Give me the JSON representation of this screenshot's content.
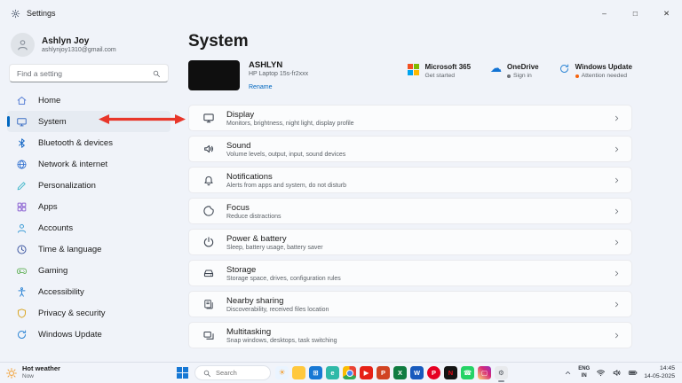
{
  "colors": {
    "accent": "#0067c0",
    "annotation_arrow": "#e8362a",
    "attention_dot": "#f7630c",
    "signin_dot": "#6f7379"
  },
  "titlebar": {
    "title": "Settings",
    "window_controls": {
      "minimize": "–",
      "maximize": "□",
      "close": "✕"
    }
  },
  "sidebar": {
    "user": {
      "name": "Ashlyn Joy",
      "email": "ashlynjoy1310@gmail.com"
    },
    "search_placeholder": "Find a setting",
    "items": [
      {
        "key": "home",
        "icon": "home",
        "label": "Home",
        "fg": "#5a81d6"
      },
      {
        "key": "system",
        "icon": "display",
        "label": "System",
        "fg": "#3c6fc4",
        "selected": true
      },
      {
        "key": "bluetooth-devices",
        "icon": "bluetooth",
        "label": "Bluetooth & devices",
        "fg": "#1467c6"
      },
      {
        "key": "network-internet",
        "icon": "network",
        "label": "Network & internet",
        "fg": "#2f6fd0"
      },
      {
        "key": "personalization",
        "icon": "personalization",
        "label": "Personalization",
        "fg": "#3fb6c9"
      },
      {
        "key": "apps",
        "icon": "apps",
        "label": "Apps",
        "fg": "#8d64d2"
      },
      {
        "key": "accounts",
        "icon": "person",
        "label": "Accounts",
        "fg": "#3a9bd5"
      },
      {
        "key": "time-language",
        "icon": "time",
        "label": "Time & language",
        "fg": "#39539f"
      },
      {
        "key": "gaming",
        "icon": "gaming",
        "label": "Gaming",
        "fg": "#56ab4a"
      },
      {
        "key": "accessibility",
        "icon": "accessibility",
        "label": "Accessibility",
        "fg": "#2f86d5"
      },
      {
        "key": "privacy-security",
        "icon": "privacy",
        "label": "Privacy & security",
        "fg": "#d9a521"
      },
      {
        "key": "windows-update",
        "icon": "update",
        "label": "Windows Update",
        "fg": "#2f86d5"
      }
    ]
  },
  "main": {
    "page_title": "System",
    "device": {
      "name": "ASHLYN",
      "model": "HP Laptop 15s-fr2xxx",
      "rename_label": "Rename"
    },
    "status_cards": [
      {
        "key": "microsoft-365",
        "title": "Microsoft 365",
        "subtitle": "Get started"
      },
      {
        "key": "onedrive",
        "title": "OneDrive",
        "subtitle": "Sign in"
      },
      {
        "key": "windows-update",
        "title": "Windows Update",
        "subtitle": "Attention needed"
      }
    ],
    "rows": [
      {
        "key": "display",
        "icon": "display",
        "title": "Display",
        "subtitle": "Monitors, brightness, night light, display profile"
      },
      {
        "key": "sound",
        "icon": "sound",
        "title": "Sound",
        "subtitle": "Volume levels, output, input, sound devices"
      },
      {
        "key": "notifications",
        "icon": "notifications",
        "title": "Notifications",
        "subtitle": "Alerts from apps and system, do not disturb"
      },
      {
        "key": "focus",
        "icon": "focus",
        "title": "Focus",
        "subtitle": "Reduce distractions"
      },
      {
        "key": "power-battery",
        "icon": "power",
        "title": "Power & battery",
        "subtitle": "Sleep, battery usage, battery saver"
      },
      {
        "key": "storage",
        "icon": "storage",
        "title": "Storage",
        "subtitle": "Storage space, drives, configuration rules"
      },
      {
        "key": "nearby-sharing",
        "icon": "nearby",
        "title": "Nearby sharing",
        "subtitle": "Discoverability, received files location"
      },
      {
        "key": "multitasking",
        "icon": "multitask",
        "title": "Multitasking",
        "subtitle": "Snap windows, desktops, task switching"
      }
    ]
  },
  "annotations": {
    "arrows": [
      {
        "target": "sidebar-item-system"
      },
      {
        "target": "display-row"
      }
    ]
  },
  "taskbar": {
    "weather": {
      "title": "Hot weather",
      "subtitle": "Now"
    },
    "search_placeholder": "Search",
    "app_icons": [
      {
        "key": "widgets",
        "glyph": "☀",
        "bg": "#eaf4ff",
        "fg": "#f2a33c"
      },
      {
        "key": "file-explorer",
        "glyph": "",
        "bg": "#ffc83d",
        "fg": "#ffffff"
      },
      {
        "key": "microsoft-store",
        "glyph": "⊞",
        "bg": "#1778d4",
        "fg": "#ffffff"
      },
      {
        "key": "edge",
        "glyph": "e",
        "bg": "#2fb9a8",
        "fg": "#ffffff"
      },
      {
        "key": "chrome",
        "glyph": "",
        "fg": "#ffffff"
      },
      {
        "key": "youtube",
        "glyph": "▶",
        "bg": "#e62117",
        "fg": "#ffffff"
      },
      {
        "key": "powerpoint",
        "glyph": "P",
        "bg": "#d14423",
        "fg": "#ffffff"
      },
      {
        "key": "excel",
        "glyph": "X",
        "bg": "#107c41",
        "fg": "#ffffff"
      },
      {
        "key": "word",
        "glyph": "W",
        "bg": "#185abd",
        "fg": "#ffffff"
      },
      {
        "key": "pinterest",
        "glyph": "P",
        "bg": "#e60023",
        "fg": "#ffffff"
      },
      {
        "key": "netflix",
        "glyph": "N",
        "bg": "#141414",
        "fg": "#e50914"
      },
      {
        "key": "whatsapp",
        "glyph": "☎",
        "bg": "#25d366",
        "fg": "#ffffff"
      },
      {
        "key": "instagram",
        "glyph": "▢",
        "fg": "#ffffff"
      },
      {
        "key": "settings",
        "glyph": "⚙",
        "bg": "#e8eaed",
        "fg": "#51575e"
      }
    ],
    "tray": {
      "language": "ENG",
      "region": "IN",
      "time": "14:45",
      "date": "14-05-2025"
    }
  }
}
